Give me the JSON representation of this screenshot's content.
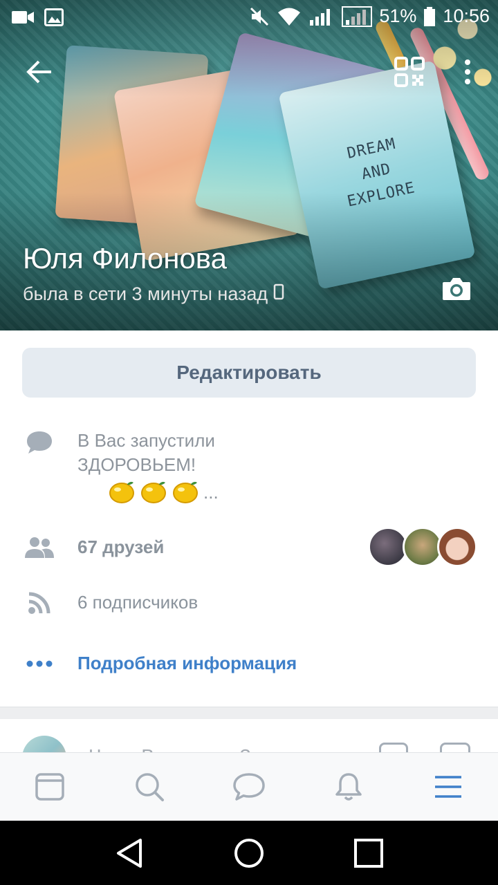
{
  "status_bar": {
    "battery_percent": "51%",
    "time": "10:56",
    "icons": [
      "video-icon",
      "image-icon",
      "mute-icon",
      "wifi-icon",
      "signal-icon",
      "signal-2-icon",
      "battery-icon"
    ]
  },
  "profile": {
    "name": "Юля Филонова",
    "last_seen": "была в сети 3 минуты назад",
    "cover_book_text": "DREAM\nAND\nEXPLORE"
  },
  "actions": {
    "edit_label": "Редактировать"
  },
  "info": {
    "status_line1": "В Вас запустили",
    "status_line2": "ЗДОРОВЬЕМ!",
    "status_ellipsis": "...",
    "friends": "67 друзей",
    "followers": "6 подписчиков",
    "details_link": "Подробная информация"
  },
  "composer": {
    "placeholder": "Что у Вас нового?"
  },
  "tabs": [
    {
      "name": "news-icon"
    },
    {
      "name": "search-icon"
    },
    {
      "name": "messages-icon"
    },
    {
      "name": "notifications-icon"
    },
    {
      "name": "menu-icon",
      "active": true
    }
  ],
  "colors": {
    "accent": "#3f80c9",
    "edit_button_bg": "#e5ebf1",
    "edit_button_text": "#55677d",
    "secondary_text": "#8a939c",
    "icon_gray": "#a5aeb8"
  }
}
